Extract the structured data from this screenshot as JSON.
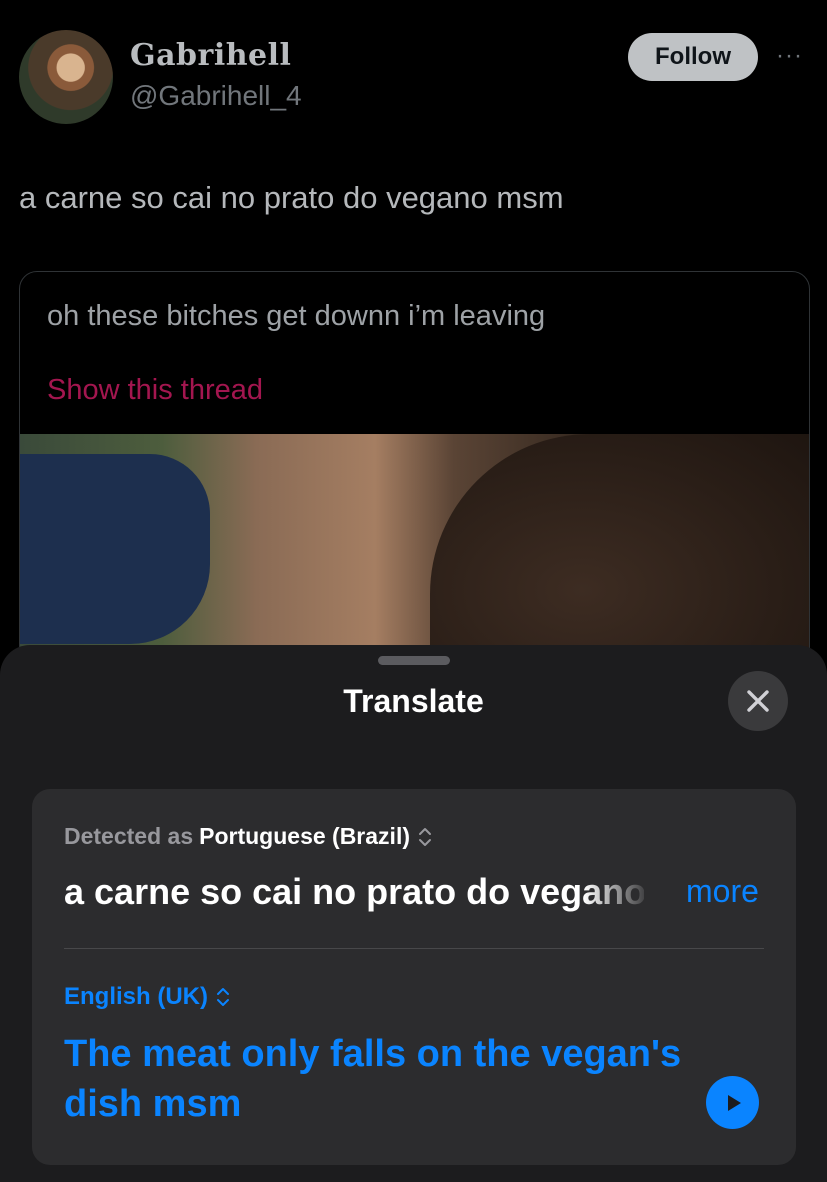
{
  "tweet": {
    "display_name": "Gabrihell",
    "handle": "@Gabrihell_4",
    "follow_label": "Follow",
    "more_label": "···",
    "text": "a carne so cai no prato do vegano msm",
    "quote": {
      "text": "oh these bitches get downn i’m leaving",
      "show_thread_label": "Show this thread"
    }
  },
  "translate": {
    "title": "Translate",
    "detected_prefix": "Detected as",
    "detected_language": "Portuguese (Brazil)",
    "source_text": "a carne so cai no prato do vegano msm",
    "more_label": "more",
    "target_language": "English (UK)",
    "translated_text": "The meat only falls on the vegan's dish msm"
  },
  "icons": {
    "close": "close-icon",
    "chevron": "chevron-up-down-icon",
    "play": "play-icon"
  },
  "colors": {
    "accent": "#0a84ff",
    "thread_link": "#a3164f",
    "sheet_bg": "#1c1c1e",
    "card_bg": "#2c2c2e"
  }
}
